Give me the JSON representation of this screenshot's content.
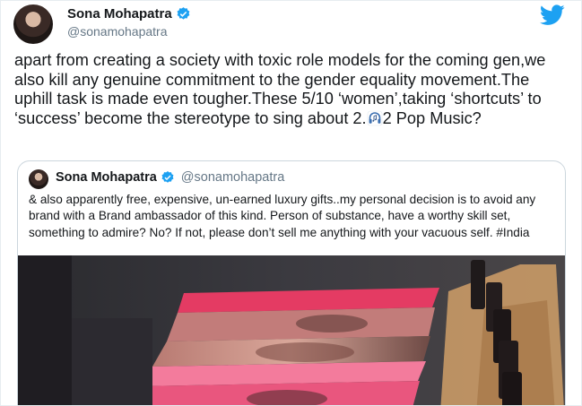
{
  "tweet": {
    "author_name": "Sona Mohapatra",
    "author_handle": "@sonamohapatra",
    "text_before_emoji": "apart from creating a society with toxic role models for the coming gen,we also kill any genuine commitment to the gender equality movement.The uphill task is made even tougher.These 5/10 ‘women’,taking ‘shortcuts’ to ‘success’ become the stereotype to sing about 2.",
    "text_after_emoji": "2 Pop Music?",
    "emoji_icon": "headphones-music-emoji"
  },
  "quoted_tweet": {
    "author_name": "Sona Mohapatra",
    "author_handle": "@sonamohapatra",
    "text": "& also apparently free, expensive, un-earned luxury gifts..my personal decision is to avoid any brand with a  Brand ambassador of this kind. Person of substance, have a worthy skill set, something to admire? No? If not, please don’t sell me anything with your vacuous self. #India"
  },
  "colors": {
    "text": "#14171a",
    "secondary_text": "#657786",
    "twitter_blue": "#1da1f2",
    "border": "#ccd6dd"
  }
}
